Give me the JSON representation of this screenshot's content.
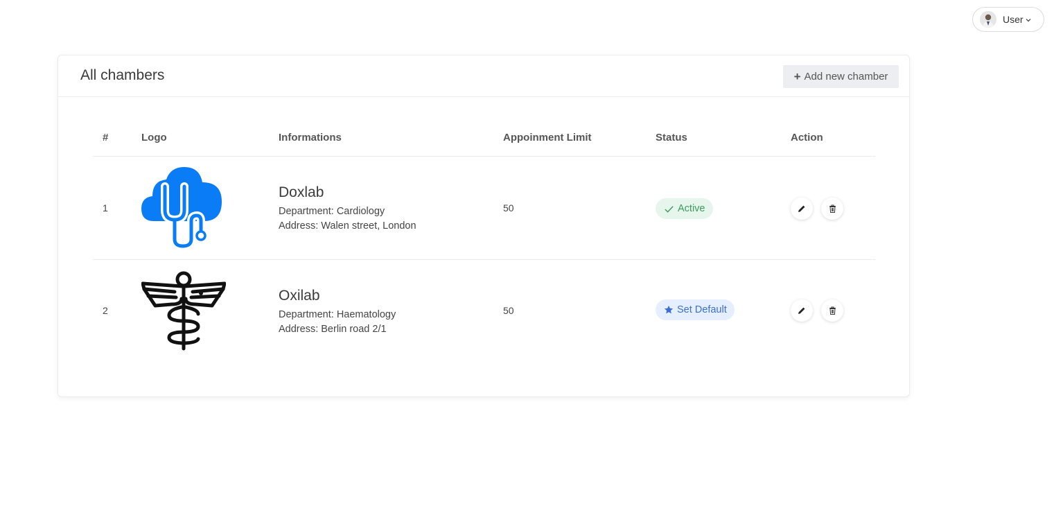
{
  "user": {
    "label": "User"
  },
  "card": {
    "title": "All chambers",
    "add_button": "Add new chamber"
  },
  "table": {
    "headers": [
      "#",
      "Logo",
      "Informations",
      "Appoinment Limit",
      "Status",
      "Action"
    ],
    "rows": [
      {
        "num": "1",
        "logo": "cloud-stethoscope-logo",
        "name": "Doxlab",
        "department": "Department: Cardiology",
        "address": "Address: Walen street, London",
        "limit": "50",
        "status": "Active"
      },
      {
        "num": "2",
        "logo": "caduceus-logo",
        "name": "Oxilab",
        "department": "Department: Haematology",
        "address": "Address: Berlin road 2/1",
        "limit": "50",
        "status": "Set Default"
      }
    ]
  },
  "colors": {
    "active_bg": "#e7f6ec",
    "active_text": "#3a9d58",
    "default_bg": "#e6efff",
    "default_text": "#3c6fd1",
    "logo_blue": "#0a7cf5"
  }
}
